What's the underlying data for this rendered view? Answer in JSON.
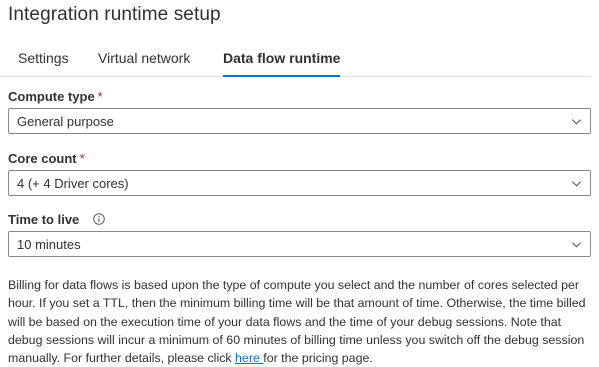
{
  "header": {
    "title": "Integration runtime setup"
  },
  "tabs": [
    {
      "label": "Settings"
    },
    {
      "label": "Virtual network"
    },
    {
      "label": "Data flow runtime"
    }
  ],
  "form": {
    "compute_type": {
      "label": "Compute type",
      "required": "*",
      "value": "General purpose"
    },
    "core_count": {
      "label": "Core count",
      "required": "*",
      "value": "4 (+ 4 Driver cores)"
    },
    "ttl": {
      "label": "Time to live",
      "value": "10 minutes"
    }
  },
  "description": {
    "text_before": "Billing for data flows is based upon the type of compute you select and the number of cores selected per hour. If you set a TTL, then the minimum billing time will be that amount of time. Otherwise, the time billed will be based on the execution time of your data flows and the time of your debug sessions. Note that debug sessions will incur a minimum of 60 minutes of billing time unless you switch off the debug session manually. For further details, please click ",
    "link_text": "here ",
    "text_after": "for the pricing page."
  },
  "colors": {
    "accent": "#0078d4",
    "required": "#a4262c",
    "text": "#323130",
    "border": "#8a8886"
  },
  "icons": {
    "info": "info-icon",
    "dropdown": "chevron-down-icon"
  }
}
